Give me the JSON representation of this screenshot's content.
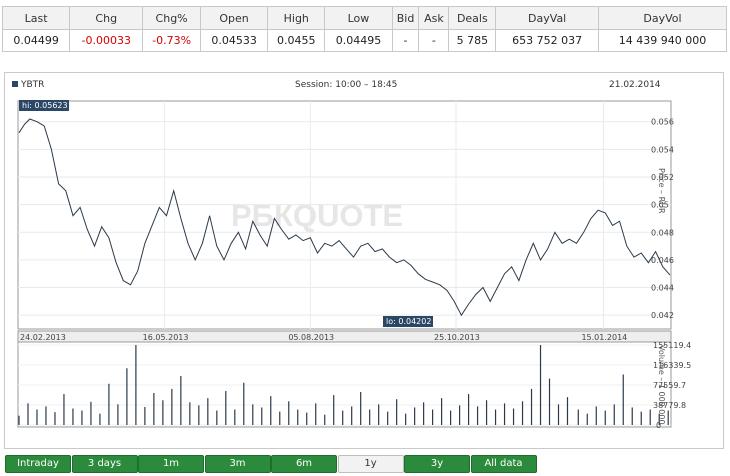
{
  "quote_table": {
    "headers": [
      "Last",
      "Chg",
      "Chg%",
      "Open",
      "High",
      "Low",
      "Bid",
      "Ask",
      "Deals",
      "DayVal",
      "DayVol"
    ],
    "values": [
      "0.04499",
      "-0.00033",
      "-0.73%",
      "0.04533",
      "0.0455",
      "0.04495",
      "-",
      "-",
      "5 785",
      "653 752 037",
      "14 439 940 000"
    ],
    "negative_color": "#d40000"
  },
  "chart": {
    "ticker": "YBTR",
    "session": "Session: 10:00 – 18:45",
    "date": "21.02.2014",
    "watermark": "РБКQUOTE",
    "hi_label": "hi: 0.05623",
    "lo_label": "lo: 0.04202",
    "price_axis_label": "Price – RUR",
    "volume_axis_label": "Volume – 1 000 000",
    "x_ticks": [
      "24.02.2013",
      "16.05.2013",
      "05.08.2013",
      "25.10.2013",
      "15.01.2014"
    ],
    "price_ticks": [
      "0.056",
      "0.054",
      "0.052",
      "0.05",
      "0.048",
      "0.046",
      "0.044",
      "0.042"
    ],
    "volume_ticks": [
      "155119.4",
      "116339.5",
      "77559.7",
      "38779.8",
      "0"
    ],
    "line_color": "#2b3a4a",
    "label_bg": "#2b4766"
  },
  "chart_data": {
    "type": "line",
    "title": "YBTR",
    "x_range": [
      "24.02.2013",
      "21.02.2014"
    ],
    "ylim": [
      0.041,
      0.0575
    ],
    "price_series": [
      [
        "2013-02-24",
        0.0552
      ],
      [
        "2013-02-27",
        0.0558
      ],
      [
        "2013-03-02",
        0.0562
      ],
      [
        "2013-03-06",
        0.056
      ],
      [
        "2013-03-10",
        0.0557
      ],
      [
        "2013-03-14",
        0.054
      ],
      [
        "2013-03-18",
        0.0515
      ],
      [
        "2013-03-22",
        0.051
      ],
      [
        "2013-03-26",
        0.0492
      ],
      [
        "2013-03-30",
        0.0498
      ],
      [
        "2013-04-03",
        0.0482
      ],
      [
        "2013-04-07",
        0.047
      ],
      [
        "2013-04-11",
        0.0484
      ],
      [
        "2013-04-15",
        0.0476
      ],
      [
        "2013-04-19",
        0.0458
      ],
      [
        "2013-04-23",
        0.0445
      ],
      [
        "2013-04-27",
        0.0442
      ],
      [
        "2013-05-01",
        0.0452
      ],
      [
        "2013-05-05",
        0.0472
      ],
      [
        "2013-05-09",
        0.0485
      ],
      [
        "2013-05-13",
        0.0498
      ],
      [
        "2013-05-17",
        0.0492
      ],
      [
        "2013-05-21",
        0.051
      ],
      [
        "2013-05-25",
        0.049
      ],
      [
        "2013-05-29",
        0.0472
      ],
      [
        "2013-06-02",
        0.046
      ],
      [
        "2013-06-06",
        0.0472
      ],
      [
        "2013-06-10",
        0.0492
      ],
      [
        "2013-06-14",
        0.047
      ],
      [
        "2013-06-18",
        0.046
      ],
      [
        "2013-06-22",
        0.0472
      ],
      [
        "2013-06-26",
        0.048
      ],
      [
        "2013-06-30",
        0.0468
      ],
      [
        "2013-07-04",
        0.0488
      ],
      [
        "2013-07-08",
        0.0478
      ],
      [
        "2013-07-12",
        0.047
      ],
      [
        "2013-07-16",
        0.049
      ],
      [
        "2013-07-20",
        0.0482
      ],
      [
        "2013-07-24",
        0.0475
      ],
      [
        "2013-07-28",
        0.0478
      ],
      [
        "2013-08-01",
        0.0474
      ],
      [
        "2013-08-05",
        0.0476
      ],
      [
        "2013-08-09",
        0.0465
      ],
      [
        "2013-08-13",
        0.0472
      ],
      [
        "2013-08-17",
        0.047
      ],
      [
        "2013-08-21",
        0.0474
      ],
      [
        "2013-08-25",
        0.0468
      ],
      [
        "2013-08-29",
        0.0462
      ],
      [
        "2013-09-02",
        0.047
      ],
      [
        "2013-09-06",
        0.0472
      ],
      [
        "2013-09-10",
        0.0466
      ],
      [
        "2013-09-14",
        0.0468
      ],
      [
        "2013-09-18",
        0.0462
      ],
      [
        "2013-09-22",
        0.0458
      ],
      [
        "2013-09-26",
        0.046
      ],
      [
        "2013-09-30",
        0.0456
      ],
      [
        "2013-10-04",
        0.045
      ],
      [
        "2013-10-08",
        0.0446
      ],
      [
        "2013-10-12",
        0.0444
      ],
      [
        "2013-10-16",
        0.0442
      ],
      [
        "2013-10-20",
        0.0438
      ],
      [
        "2013-10-24",
        0.043
      ],
      [
        "2013-10-28",
        0.042
      ],
      [
        "2013-11-01",
        0.0428
      ],
      [
        "2013-11-05",
        0.0435
      ],
      [
        "2013-11-09",
        0.044
      ],
      [
        "2013-11-13",
        0.043
      ],
      [
        "2013-11-17",
        0.044
      ],
      [
        "2013-11-21",
        0.045
      ],
      [
        "2013-11-25",
        0.0455
      ],
      [
        "2013-11-29",
        0.0445
      ],
      [
        "2013-12-03",
        0.046
      ],
      [
        "2013-12-07",
        0.0472
      ],
      [
        "2013-12-11",
        0.046
      ],
      [
        "2013-12-15",
        0.0468
      ],
      [
        "2013-12-19",
        0.048
      ],
      [
        "2013-12-23",
        0.0472
      ],
      [
        "2013-12-27",
        0.0475
      ],
      [
        "2013-12-31",
        0.0472
      ],
      [
        "2014-01-04",
        0.048
      ],
      [
        "2014-01-08",
        0.049
      ],
      [
        "2014-01-12",
        0.0496
      ],
      [
        "2014-01-16",
        0.0494
      ],
      [
        "2014-01-20",
        0.0485
      ],
      [
        "2014-01-24",
        0.0488
      ],
      [
        "2014-01-28",
        0.047
      ],
      [
        "2014-02-01",
        0.0462
      ],
      [
        "2014-02-05",
        0.0465
      ],
      [
        "2014-02-09",
        0.0458
      ],
      [
        "2014-02-13",
        0.0466
      ],
      [
        "2014-02-17",
        0.0455
      ],
      [
        "2014-02-21",
        0.0449
      ]
    ],
    "volume_series": [
      [
        "2013-02-24",
        18000
      ],
      [
        "2013-03-01",
        42000
      ],
      [
        "2013-03-06",
        30000
      ],
      [
        "2013-03-11",
        36000
      ],
      [
        "2013-03-16",
        25000
      ],
      [
        "2013-03-21",
        60000
      ],
      [
        "2013-03-26",
        32000
      ],
      [
        "2013-03-31",
        28000
      ],
      [
        "2013-04-05",
        45000
      ],
      [
        "2013-04-10",
        22000
      ],
      [
        "2013-04-15",
        80000
      ],
      [
        "2013-04-20",
        40000
      ],
      [
        "2013-04-25",
        110000
      ],
      [
        "2013-04-30",
        155000
      ],
      [
        "2013-05-05",
        35000
      ],
      [
        "2013-05-10",
        62000
      ],
      [
        "2013-05-15",
        48000
      ],
      [
        "2013-05-20",
        70000
      ],
      [
        "2013-05-25",
        95000
      ],
      [
        "2013-05-30",
        44000
      ],
      [
        "2013-06-04",
        38000
      ],
      [
        "2013-06-09",
        52000
      ],
      [
        "2013-06-14",
        28000
      ],
      [
        "2013-06-19",
        66000
      ],
      [
        "2013-06-24",
        30000
      ],
      [
        "2013-06-29",
        82000
      ],
      [
        "2013-07-04",
        40000
      ],
      [
        "2013-07-09",
        34000
      ],
      [
        "2013-07-14",
        56000
      ],
      [
        "2013-07-19",
        26000
      ],
      [
        "2013-07-24",
        46000
      ],
      [
        "2013-07-29",
        30000
      ],
      [
        "2013-08-03",
        24000
      ],
      [
        "2013-08-08",
        42000
      ],
      [
        "2013-08-13",
        20000
      ],
      [
        "2013-08-18",
        58000
      ],
      [
        "2013-08-23",
        28000
      ],
      [
        "2013-08-28",
        36000
      ],
      [
        "2013-09-02",
        64000
      ],
      [
        "2013-09-07",
        30000
      ],
      [
        "2013-09-12",
        40000
      ],
      [
        "2013-09-17",
        26000
      ],
      [
        "2013-09-22",
        50000
      ],
      [
        "2013-09-27",
        22000
      ],
      [
        "2013-10-02",
        34000
      ],
      [
        "2013-10-07",
        44000
      ],
      [
        "2013-10-12",
        30000
      ],
      [
        "2013-10-17",
        52000
      ],
      [
        "2013-10-22",
        28000
      ],
      [
        "2013-10-27",
        38000
      ],
      [
        "2013-11-01",
        60000
      ],
      [
        "2013-11-06",
        36000
      ],
      [
        "2013-11-11",
        48000
      ],
      [
        "2013-11-16",
        30000
      ],
      [
        "2013-11-21",
        42000
      ],
      [
        "2013-11-26",
        32000
      ],
      [
        "2013-12-01",
        46000
      ],
      [
        "2013-12-06",
        70000
      ],
      [
        "2013-12-11",
        155000
      ],
      [
        "2013-12-16",
        90000
      ],
      [
        "2013-12-21",
        40000
      ],
      [
        "2013-12-26",
        54000
      ],
      [
        "2014-01-01",
        30000
      ],
      [
        "2014-01-06",
        22000
      ],
      [
        "2014-01-11",
        36000
      ],
      [
        "2014-01-16",
        28000
      ],
      [
        "2014-01-21",
        40000
      ],
      [
        "2014-01-26",
        98000
      ],
      [
        "2014-01-31",
        34000
      ],
      [
        "2014-02-05",
        26000
      ],
      [
        "2014-02-10",
        30000
      ],
      [
        "2014-02-15",
        22000
      ],
      [
        "2014-02-20",
        28000
      ]
    ]
  },
  "tabs": [
    {
      "label": "Intraday",
      "active": false
    },
    {
      "label": "3 days",
      "active": false
    },
    {
      "label": "1m",
      "active": false
    },
    {
      "label": "3m",
      "active": false
    },
    {
      "label": "6m",
      "active": false
    },
    {
      "label": "1y",
      "active": true
    },
    {
      "label": "3y",
      "active": false
    },
    {
      "label": "All data",
      "active": false
    }
  ]
}
